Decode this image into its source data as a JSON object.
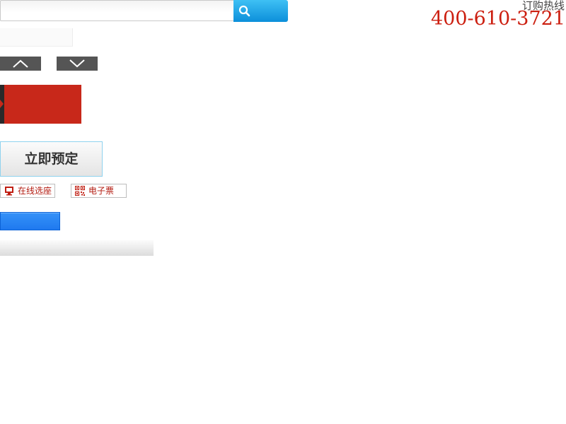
{
  "search": {
    "value": "",
    "placeholder": "",
    "button_icon": "search-icon"
  },
  "hotline": {
    "label": "订购热线",
    "number": "400-610-3721",
    "number_color": "#cc1f10"
  },
  "arrows": {
    "up_icon": "chevron-up-icon",
    "down_icon": "chevron-down-icon",
    "color": "#555555"
  },
  "red_tag": {
    "color": "#c8281a"
  },
  "book_button": {
    "label": "立即预定"
  },
  "options": [
    {
      "label": "在线选座",
      "icon": "monitor-icon"
    },
    {
      "label": "电子票",
      "icon": "qr-code-icon"
    }
  ],
  "colors": {
    "accent_blue": "#1f79ef",
    "search_blue": "#0c8fda",
    "red": "#c8281a"
  }
}
